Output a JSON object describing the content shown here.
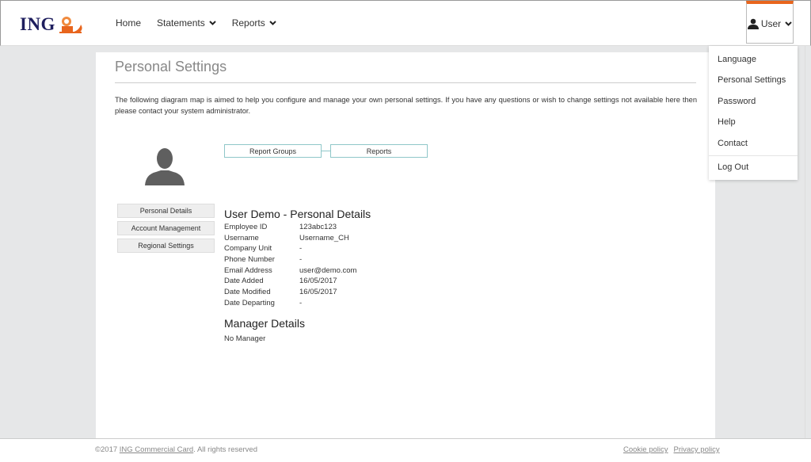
{
  "header": {
    "logo_text": "ING",
    "nav": [
      {
        "label": "Home",
        "has_dropdown": false
      },
      {
        "label": "Statements",
        "has_dropdown": true
      },
      {
        "label": "Reports",
        "has_dropdown": true
      }
    ],
    "user_label": "User",
    "accent_color": "#e8651d"
  },
  "user_menu": {
    "items": [
      "Language",
      "Personal Settings",
      "Password",
      "Help",
      "Contact"
    ],
    "logout": "Log Out"
  },
  "page": {
    "title": "Personal Settings",
    "intro": "The following diagram map is aimed to help you configure and manage your own personal settings. If you have any questions or wish to change settings not available here then please contact your system administrator.",
    "diagram": [
      "Report Groups",
      "Reports"
    ],
    "side_buttons": [
      "Personal Details",
      "Account Management",
      "Regional Settings"
    ],
    "details_title": "User Demo - Personal Details",
    "details": [
      {
        "label": "Employee ID",
        "value": "123abc123"
      },
      {
        "label": "Username",
        "value": "Username_CH"
      },
      {
        "label": "Company Unit",
        "value": "-"
      },
      {
        "label": "Phone Number",
        "value": "-"
      },
      {
        "label": "Email Address",
        "value": "user@demo.com"
      },
      {
        "label": "Date Added",
        "value": "16/05/2017"
      },
      {
        "label": "Date Modified",
        "value": "16/05/2017"
      },
      {
        "label": "Date Departing",
        "value": "-"
      }
    ],
    "manager_title": "Manager Details",
    "manager_value": "No Manager"
  },
  "footer": {
    "copyright_prefix": "©2017 ",
    "company_link": "ING Commercial Card",
    "copyright_suffix": ". All rights reserved",
    "links": [
      "Cookie policy",
      "Privacy policy"
    ]
  }
}
